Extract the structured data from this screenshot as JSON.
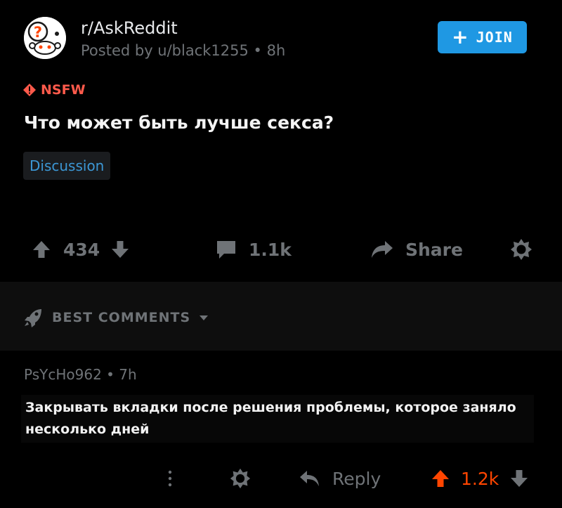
{
  "post": {
    "subreddit": "r/AskReddit",
    "posted_by": "Posted by u/black1255 • 8h",
    "join_label": "JOIN",
    "nsfw_label": "NSFW",
    "title": "Что может быть лучше секса?",
    "flair": "Discussion",
    "vote_count": "434",
    "comment_count": "1.1k",
    "share_label": "Share"
  },
  "comments_bar": {
    "sort_label": "BEST COMMENTS"
  },
  "comment": {
    "meta": "PsYcHo962 • 7h",
    "body": "Закрывать вкладки после решения проблемы, которое заняло несколько дней",
    "reply_label": "Reply",
    "vote_count": "1.2k"
  },
  "colors": {
    "background": "#000000",
    "join_button": "#1f98e3",
    "nsfw": "#ff5a4b",
    "flair_text": "#3c97d5",
    "upvote_active": "#ff4500",
    "muted": "#6f7377"
  },
  "icons": [
    "subreddit-avatar-icon",
    "plus-icon",
    "nsfw-diamond-icon",
    "upvote-icon",
    "downvote-icon",
    "comment-bubble-icon",
    "share-arrow-icon",
    "award-icon",
    "rocket-icon",
    "chevron-down-icon",
    "more-options-icon",
    "reply-arrow-icon"
  ]
}
